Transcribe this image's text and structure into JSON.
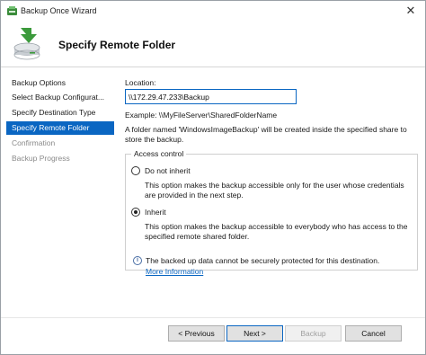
{
  "window": {
    "title": "Backup Once Wizard",
    "close_glyph": "✕"
  },
  "header": {
    "title": "Specify Remote Folder"
  },
  "nav": {
    "items": [
      {
        "label": "Backup Options",
        "state": "normal"
      },
      {
        "label": "Select Backup Configurat...",
        "state": "normal"
      },
      {
        "label": "Specify Destination Type",
        "state": "normal"
      },
      {
        "label": "Specify Remote Folder",
        "state": "active"
      },
      {
        "label": "Confirmation",
        "state": "disabled"
      },
      {
        "label": "Backup Progress",
        "state": "disabled"
      }
    ]
  },
  "content": {
    "location_label": "Location:",
    "location_value": "\\\\172.29.47.233\\Backup",
    "example_text": "Example: \\\\MyFileServer\\SharedFolderName",
    "folder_note": "A folder named 'WindowsImageBackup' will be created inside the specified share to store the backup.",
    "access_control": {
      "legend": "Access control",
      "options": [
        {
          "label": "Do not inherit",
          "description": "This option makes the backup accessible only for the user whose credentials are provided in the next step.",
          "checked": false
        },
        {
          "label": "Inherit",
          "description": "This option makes the backup accessible to everybody who has access to the specified remote shared folder.",
          "checked": true
        }
      ]
    },
    "security_note": "The backed up data cannot be securely protected for this destination.",
    "more_info_link": "More Information"
  },
  "footer": {
    "previous_label": "< Previous",
    "next_label": "Next >",
    "backup_label": "Backup",
    "cancel_label": "Cancel"
  },
  "colors": {
    "accent": "#0a66c2",
    "nav_active_bg": "#0a66c2",
    "disabled_text": "#8a8a8a"
  },
  "icons": {
    "app": "backup-app-icon",
    "wizard": "backup-wizard-icon",
    "info": "info-icon"
  }
}
